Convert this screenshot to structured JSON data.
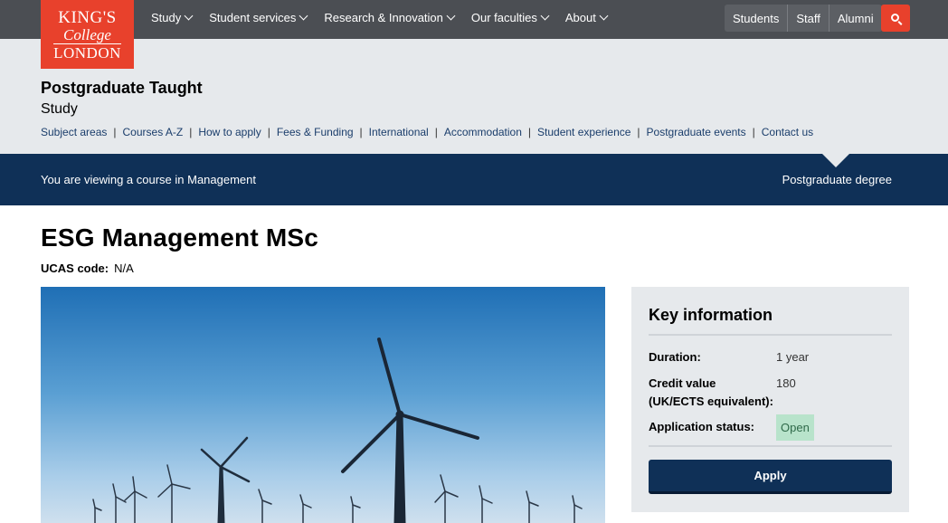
{
  "logo": {
    "line1": "KING'S",
    "line2": "College",
    "line3": "LONDON"
  },
  "nav": {
    "items": [
      {
        "label": "Study"
      },
      {
        "label": "Student services"
      },
      {
        "label": "Research & Innovation"
      },
      {
        "label": "Our faculties"
      },
      {
        "label": "About"
      }
    ],
    "audience": [
      "Students",
      "Staff",
      "Alumni"
    ]
  },
  "section": {
    "title": "Postgraduate Taught",
    "subtitle": "Study",
    "links": [
      "Subject areas",
      "Courses A-Z",
      "How to apply",
      "Fees & Funding",
      "International",
      "Accommodation",
      "Student experience",
      "Postgraduate events",
      "Contact us"
    ]
  },
  "context_bar": {
    "left": "You are viewing a course in Management",
    "right": "Postgraduate degree"
  },
  "course": {
    "title": "ESG Management MSc",
    "ucas_label": "UCAS code:",
    "ucas_value": "N/A"
  },
  "key_info": {
    "title": "Key information",
    "duration_label": "Duration:",
    "duration_value": "1 year",
    "credit_label_1": "Credit value",
    "credit_label_2": "(UK/ECTS equivalent):",
    "credit_value": "180",
    "status_label": "Application status:",
    "status_value": "Open",
    "apply_label": "Apply"
  },
  "colors": {
    "topbar": "#4b4e53",
    "brand_red": "#e8412c",
    "navy": "#0f3057",
    "section_bg": "#e6e9ec",
    "open_badge": "#b8e3cb"
  }
}
